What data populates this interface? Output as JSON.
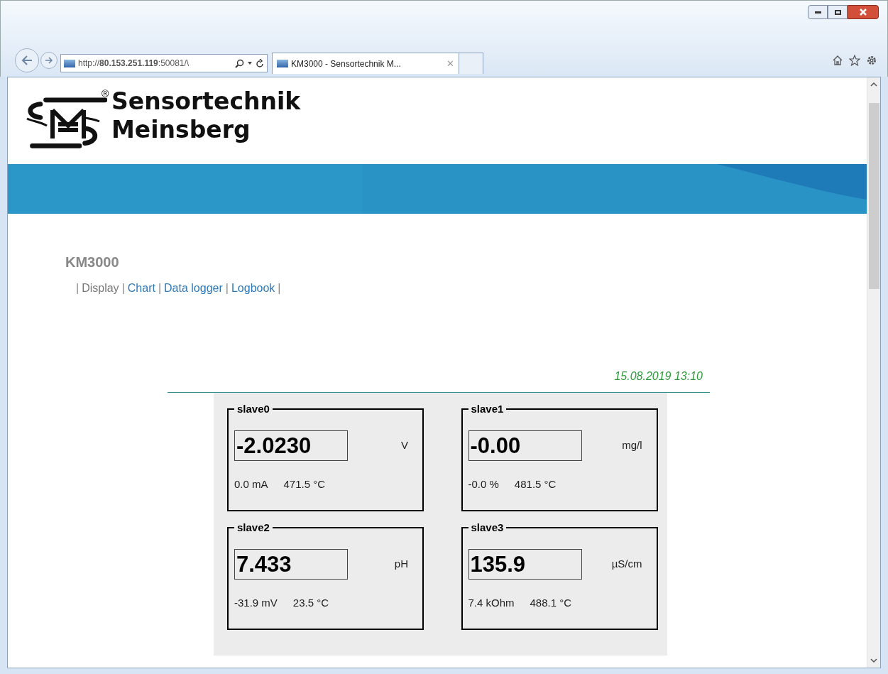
{
  "browser": {
    "address": "http://**80.153.251.119**:50081/\\",
    "tabs": [
      {
        "label": "KM3000 - Sensortechnik M...",
        "close": "✕",
        "selected": true
      }
    ]
  },
  "logo": {
    "line_1": "Sensortechnik",
    "line_2": "Meinsberg",
    "mark": "®"
  },
  "device": {
    "title": "KM3000"
  },
  "nav": [
    {
      "kind": "separator",
      "label": "|"
    },
    {
      "kind": "link",
      "label": "Display",
      "selected": true
    },
    {
      "kind": "separator",
      "label": "|"
    },
    {
      "kind": "link",
      "label": "Chart",
      "selected": false
    },
    {
      "kind": "separator",
      "label": "|"
    },
    {
      "kind": "link",
      "label": "Data logger",
      "selected": false
    },
    {
      "kind": "separator",
      "label": "|"
    },
    {
      "kind": "link",
      "label": "Logbook",
      "selected": false
    },
    {
      "kind": "separator",
      "label": "|"
    }
  ],
  "timestamp": "15.08.2019 13:10",
  "channels": [
    {
      "name": "slave0",
      "value": "-2.0230",
      "unit": "V",
      "reading_1": "0.0 mA",
      "reading_2": "471.5 °C"
    },
    {
      "name": "slave1",
      "value": "-0.00",
      "unit": "mg/l",
      "reading_1": "-0.0 %",
      "reading_2": "481.5 °C"
    },
    {
      "name": "slave2",
      "value": "7.433",
      "unit": "pH",
      "reading_1": "-31.9 mV",
      "reading_2": "23.5 °C"
    },
    {
      "name": "slave3",
      "value": "135.9",
      "unit": "µS/cm",
      "reading_1": "7.4 kOhm",
      "reading_2": "488.1 °C"
    }
  ]
}
